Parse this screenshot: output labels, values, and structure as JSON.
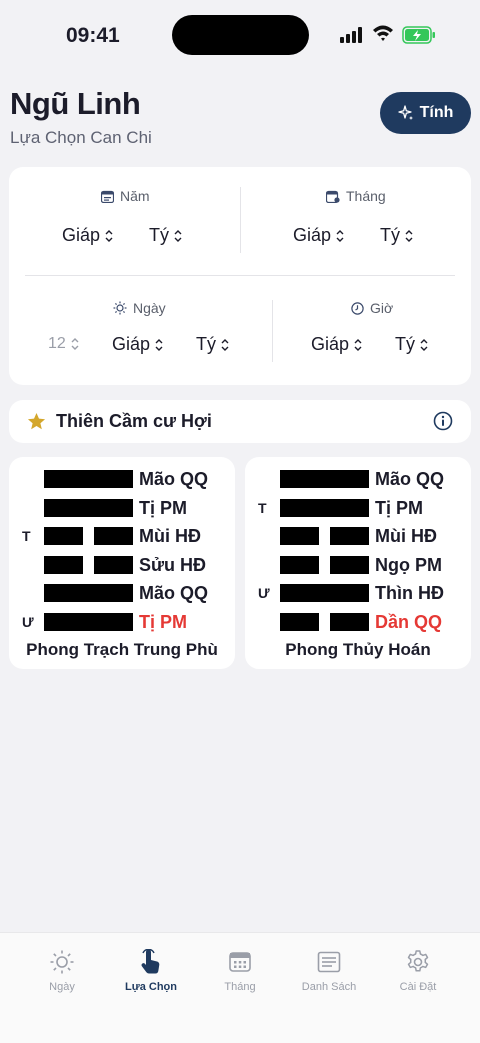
{
  "status_bar": {
    "time": "09:41"
  },
  "header": {
    "title": "Ngũ Linh",
    "subtitle": "Lựa Chọn Can Chi",
    "calc_label": "Tính"
  },
  "selectors": {
    "year": {
      "label": "Năm",
      "stem": "Giáp",
      "branch": "Tý"
    },
    "month": {
      "label": "Tháng",
      "stem": "Giáp",
      "branch": "Tý"
    },
    "day": {
      "label": "Ngày",
      "number": "12",
      "stem": "Giáp",
      "branch": "Tý"
    },
    "hour": {
      "label": "Giờ",
      "stem": "Giáp",
      "branch": "Tý"
    }
  },
  "info": {
    "title": "Thiên Cầm cư Hợi",
    "star_color": "#d4a72c"
  },
  "hexagrams": [
    {
      "name": "Phong Trạch Trung Phù",
      "lines": [
        {
          "type": "yang",
          "marker": "",
          "label": "Mão QQ",
          "highlight": false
        },
        {
          "type": "yang",
          "marker": "",
          "label": "Tị PM",
          "highlight": false
        },
        {
          "type": "yin",
          "marker": "T",
          "label": "Mùi HĐ",
          "highlight": false
        },
        {
          "type": "yin",
          "marker": "",
          "label": "Sửu HĐ",
          "highlight": false
        },
        {
          "type": "yang",
          "marker": "",
          "label": "Mão QQ",
          "highlight": false
        },
        {
          "type": "yang",
          "marker": "Ư",
          "label": "Tị PM",
          "highlight": true
        }
      ]
    },
    {
      "name": "Phong Thủy Hoán",
      "lines": [
        {
          "type": "yang",
          "marker": "",
          "label": "Mão QQ",
          "highlight": false
        },
        {
          "type": "yang",
          "marker": "T",
          "label": "Tị PM",
          "highlight": false
        },
        {
          "type": "yin",
          "marker": "",
          "label": "Mùi HĐ",
          "highlight": false
        },
        {
          "type": "yin",
          "marker": "",
          "label": "Ngọ PM",
          "highlight": false
        },
        {
          "type": "yang",
          "marker": "Ư",
          "label": "Thìn HĐ",
          "highlight": false
        },
        {
          "type": "yin",
          "marker": "",
          "label": "Dần QQ",
          "highlight": true
        }
      ]
    }
  ],
  "tabs": [
    {
      "label": "Ngày",
      "icon": "sun-icon",
      "active": false
    },
    {
      "label": "Lựa Chọn",
      "icon": "tap-hand-icon",
      "active": true
    },
    {
      "label": "Tháng",
      "icon": "calendar-icon",
      "active": false
    },
    {
      "label": "Danh Sách",
      "icon": "list-icon",
      "active": false
    },
    {
      "label": "Cài Đặt",
      "icon": "gear-icon",
      "active": false
    }
  ],
  "colors": {
    "accent": "#1f3a5f",
    "highlight": "#e53935"
  }
}
